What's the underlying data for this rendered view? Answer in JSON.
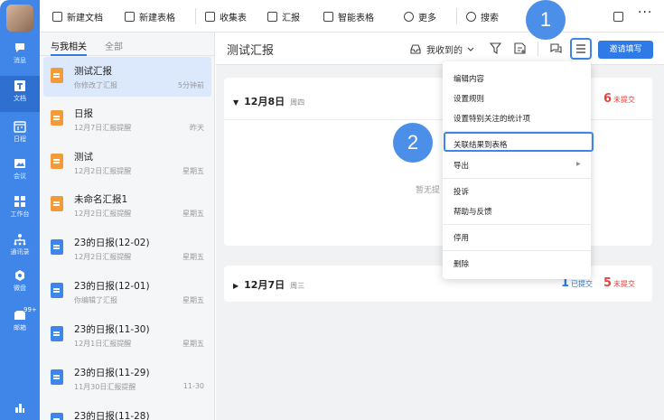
{
  "rail": {
    "items": [
      {
        "label": "消息",
        "icon": "chat-bubble-icon"
      },
      {
        "label": "文档",
        "icon": "document-icon"
      },
      {
        "label": "日程",
        "icon": "calendar-icon"
      },
      {
        "label": "会议",
        "icon": "video-icon"
      },
      {
        "label": "工作台",
        "icon": "grid-icon"
      },
      {
        "label": "通讯录",
        "icon": "contacts-icon"
      },
      {
        "label": "微盘",
        "icon": "disk-icon"
      },
      {
        "label": "邮箱",
        "icon": "mail-icon",
        "badge": "99+"
      }
    ]
  },
  "toolbar": {
    "new_doc": "新建文档",
    "new_sheet": "新建表格",
    "collect": "收集表",
    "report": "汇报",
    "smart_sheet": "智能表格",
    "more": "更多",
    "search": "搜索"
  },
  "list": {
    "tabs": [
      "与我相关",
      "全部"
    ],
    "items": [
      {
        "title": "测试汇报",
        "sub": "你修改了汇报",
        "time": "5分钟前",
        "color": "orange"
      },
      {
        "title": "日报",
        "sub": "12月7日汇报提醒",
        "time": "昨天",
        "color": "orange"
      },
      {
        "title": "测试",
        "sub": "12月2日汇报提醒",
        "time": "星期五",
        "color": "orange"
      },
      {
        "title": "未命名汇报1",
        "sub": "12月2日汇报提醒",
        "time": "星期五",
        "color": "orange"
      },
      {
        "title": "23的日报(12-02)",
        "sub": "12月2日汇报提醒",
        "time": "星期五",
        "color": "blue"
      },
      {
        "title": "23的日报(12-01)",
        "sub": "你编辑了汇报",
        "time": "星期五",
        "color": "blue"
      },
      {
        "title": "23的日报(11-30)",
        "sub": "12月1日汇报提醒",
        "time": "星期五",
        "color": "blue"
      },
      {
        "title": "23的日报(11-29)",
        "sub": "11月30日汇报提醒",
        "time": "11-30",
        "color": "blue"
      },
      {
        "title": "23的日报(11-28)",
        "sub": "",
        "time": "",
        "color": "blue"
      }
    ]
  },
  "main": {
    "title": "测试汇报",
    "filter": "我收到的",
    "invite": "邀请填写",
    "cards": [
      {
        "date": "12月8日",
        "weekday": "周四",
        "unsubmitted_count": "6",
        "unsubmitted_label": "未提交",
        "empty_text": "暂无提"
      },
      {
        "date": "12月7日",
        "weekday": "周三",
        "submitted_count": "1",
        "submitted_label": "已提交",
        "unsubmitted_count": "5",
        "unsubmitted_label": "未提交"
      }
    ]
  },
  "menu": {
    "items": [
      "编辑内容",
      "设置规则",
      "设置特别关注的统计项",
      "关联结果到表格",
      "导出",
      "投诉",
      "帮助与反馈",
      "停用",
      "删除"
    ]
  },
  "steps": [
    "1",
    "2"
  ],
  "colors": {
    "accent": "#2f7ae5",
    "rail": "#3f86e8",
    "alert": "#e8423a"
  }
}
